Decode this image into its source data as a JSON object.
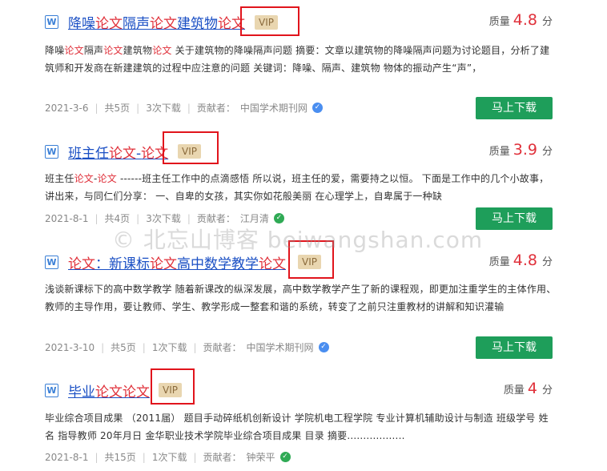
{
  "watermark": "© 北忘山博客 beiwangshan.com",
  "labels": {
    "score_label": "质量",
    "score_unit": "分",
    "vip": "VIP",
    "download": "马上下载",
    "contributor_prefix": "贡献者："
  },
  "items": [
    {
      "title_parts": [
        {
          "text": "降噪",
          "hl": false
        },
        {
          "text": "论文",
          "hl": true
        },
        {
          "text": "隔声",
          "hl": false
        },
        {
          "text": "论文",
          "hl": true
        },
        {
          "text": "建筑物",
          "hl": false
        },
        {
          "text": "论文",
          "hl": true
        }
      ],
      "score": "4.8",
      "summary_parts": [
        {
          "text": "降噪",
          "hl": false
        },
        {
          "text": "论文",
          "hl": true
        },
        {
          "text": "隔声",
          "hl": false
        },
        {
          "text": "论文",
          "hl": true
        },
        {
          "text": "建筑物",
          "hl": false
        },
        {
          "text": "论文",
          "hl": true
        },
        {
          "text": " 关于建筑物的降噪隔声问题 摘要：文章以建筑物的降噪隔声问题为讨论题目，分析了建筑师和开发商在新建建筑的过程中应注意的问题 关键词：降噪、隔声、建筑物 物体的振动产生“声”，",
          "hl": false
        }
      ],
      "date": "2021-3-6",
      "pages": "共5页",
      "downloads": "3次下载",
      "contributor": "中国学术期刊网",
      "verified": "blue"
    },
    {
      "title_parts": [
        {
          "text": "班主任",
          "hl": false
        },
        {
          "text": "论文",
          "hl": true
        },
        {
          "text": "-",
          "hl": false
        },
        {
          "text": "论文",
          "hl": true
        }
      ],
      "score": "3.9",
      "summary_parts": [
        {
          "text": "班主任",
          "hl": false
        },
        {
          "text": "论文",
          "hl": true
        },
        {
          "text": "-",
          "hl": false
        },
        {
          "text": "论文",
          "hl": true
        },
        {
          "text": " ------班主任工作中的点滴感悟 所以说，班主任的爱，需要持之以恒。 下面是工作中的几个小故事，讲出来，与同仁们分享： 一、自卑的女孩，其实你如花般美丽 在心理学上，自卑属于一种缺",
          "hl": false
        }
      ],
      "date": "2021-8-1",
      "pages": "共4页",
      "downloads": "3次下载",
      "contributor": "江月清",
      "verified": "green"
    },
    {
      "title_parts": [
        {
          "text": "论文",
          "hl": true
        },
        {
          "text": "：新课标",
          "hl": false
        },
        {
          "text": "论文",
          "hl": true
        },
        {
          "text": "高中数学教学",
          "hl": false
        },
        {
          "text": "论文",
          "hl": true
        }
      ],
      "score": "4.8",
      "summary_parts": [
        {
          "text": "浅谈新课标下的高中数学教学 随着新课改的纵深发展，高中数学教学产生了新的课程观，即更加注重学生的主体作用、教师的主导作用，要让教师、学生、教学形成一整套和谐的系统，转变了之前只注重教材的讲解和知识灌输",
          "hl": false
        }
      ],
      "date": "2021-3-10",
      "pages": "共5页",
      "downloads": "1次下载",
      "contributor": "中国学术期刊网",
      "verified": "blue"
    },
    {
      "title_parts": [
        {
          "text": "毕业",
          "hl": false
        },
        {
          "text": "论文",
          "hl": true
        },
        {
          "text": "论文",
          "hl": true
        }
      ],
      "score": "4",
      "summary_parts": [
        {
          "text": "毕业综合项目成果 （2011届） 题目手动碎纸机创新设计 学院机电工程学院 专业计算机辅助设计与制造 班级学号 姓名 指导教师 20年月日 金华职业技术学院毕业综合项目成果 目录 摘要..................",
          "hl": false
        }
      ],
      "date": "2021-8-1",
      "pages": "共15页",
      "downloads": "1次下载",
      "contributor": "钟荣平",
      "verified": "green"
    }
  ]
}
